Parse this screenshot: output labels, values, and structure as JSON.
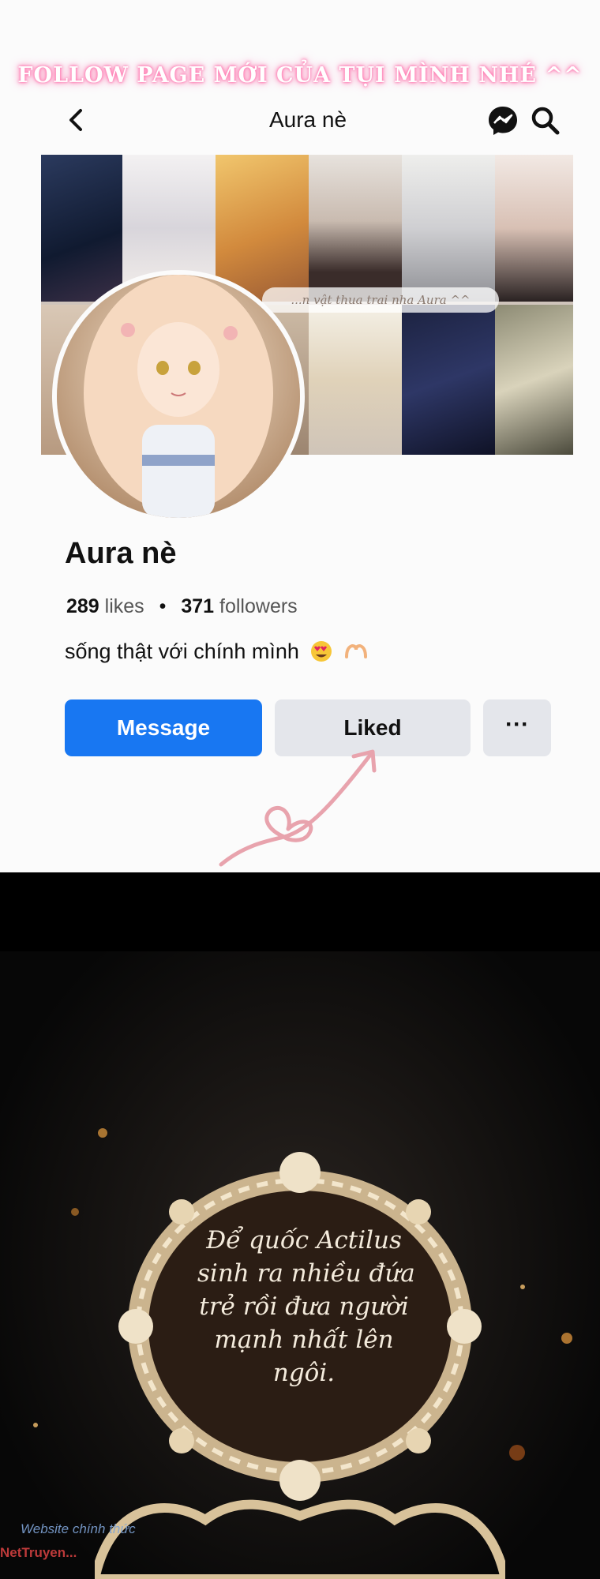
{
  "banner": {
    "text": "FOLLOW PAGE MỚI CỦA TỤI MÌNH NHÉ ^^"
  },
  "appbar": {
    "title": "Aura nè"
  },
  "cover": {
    "caption": "...n vật thua trai nha Aura ^^"
  },
  "profile": {
    "name": "Aura nè",
    "likes_count": "289",
    "likes_label": "likes",
    "followers_count": "371",
    "followers_label": "followers",
    "bio": "sống thật với chính mình"
  },
  "actions": {
    "message_label": "Message",
    "liked_label": "Liked",
    "more_label": "···"
  },
  "comic": {
    "speech_lines": [
      "Để quốc Actilus",
      "sinh ra nhiều đứa",
      "trẻ rồi đưa người",
      "mạnh nhất lên",
      "ngôi."
    ],
    "watermark_site": "Website chính thức",
    "watermark_brand": "NetTruyen..."
  },
  "colors": {
    "accent": "#1877f2",
    "button_gray": "#e4e6eb",
    "banner_glow": "#ff7fb4",
    "doodle": "#e8a3ad"
  },
  "icons": [
    "back-arrow-icon",
    "messenger-icon",
    "search-icon",
    "heart-eyes-emoji-icon",
    "heart-hands-emoji-icon",
    "more-dots-icon"
  ]
}
